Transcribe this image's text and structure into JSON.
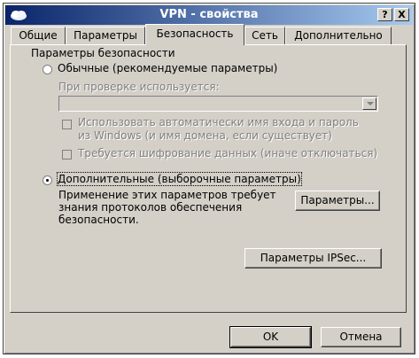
{
  "window": {
    "title": "VPN - свойства",
    "help_button": "?",
    "close_button": "X"
  },
  "tabs": [
    {
      "label": "Общие"
    },
    {
      "label": "Параметры"
    },
    {
      "label": "Безопасность",
      "active": true
    },
    {
      "label": "Сеть"
    },
    {
      "label": "Дополнительно"
    }
  ],
  "security": {
    "group_title": "Параметры безопасности",
    "typical": {
      "label": "Обычные (рекомендуемые параметры)",
      "selected": false,
      "verify_label": "При проверке используется:",
      "verify_value": "",
      "auto_logon_line1": "Использовать автоматически имя входа и пароль",
      "auto_logon_line2": "из Windows (и имя домена, если существует)",
      "require_encryption": "Требуется шифрование данных (иначе отключаться)"
    },
    "advanced": {
      "label": "Дополнительные (выборочные параметры)",
      "selected": true,
      "note_line1": "Применение этих параметров требует",
      "note_line2": "знания протоколов обеспечения",
      "note_line3": "безопасности.",
      "settings_button": "Параметры..."
    },
    "ipsec_button": "Параметры IPSec..."
  },
  "footer": {
    "ok_button": "OK",
    "cancel_button": "Отмена"
  },
  "colors": {
    "title_start": "#0a246a",
    "title_end": "#a6caf0",
    "face": "#d4d0c8",
    "disabled_text": "#808080"
  }
}
